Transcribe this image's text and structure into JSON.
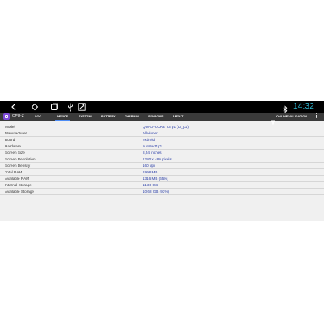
{
  "status_bar": {
    "time": "14:32",
    "icons": [
      "back-icon",
      "home-icon",
      "recents-icon",
      "usb-icon",
      "screenshot-icon",
      "bluetooth-icon"
    ]
  },
  "app": {
    "title": "CPU-Z",
    "tabs": [
      "SOC",
      "DEVICE",
      "SYSTEM",
      "BATTERY",
      "THERMAL",
      "SENSORS",
      "ABOUT"
    ],
    "active_tab": "DEVICE",
    "online_validation": "ONLINE VALIDATION"
  },
  "device_info": [
    {
      "label": "Model",
      "value": "QUAD-CORE T3 p1 (t3_p1)"
    },
    {
      "label": "Manufacturer",
      "value": "Allwinner"
    },
    {
      "label": "Board",
      "value": "exdroid"
    },
    {
      "label": "Hardware",
      "value": "sun8iw11p1"
    },
    {
      "label": "Screen Size",
      "value": "8,54 inches"
    },
    {
      "label": "Screen Resolution",
      "value": "1280 x 480 pixels"
    },
    {
      "label": "Screen Density",
      "value": "160 dpi"
    },
    {
      "label": "Total RAM",
      "value": "1998 MB"
    },
    {
      "label": "Available RAM",
      "value": "1316 MB  (65%)"
    },
    {
      "label": "Internal Storage",
      "value": "11,30 GB"
    },
    {
      "label": "Available Storage",
      "value": "10,68 GB (93%)"
    }
  ],
  "colors": {
    "accent_clock": "#2eb5d0",
    "value_text": "#2b3fa8",
    "tab_bar": "#3a3a3a",
    "logo": "#7d4ad8"
  }
}
